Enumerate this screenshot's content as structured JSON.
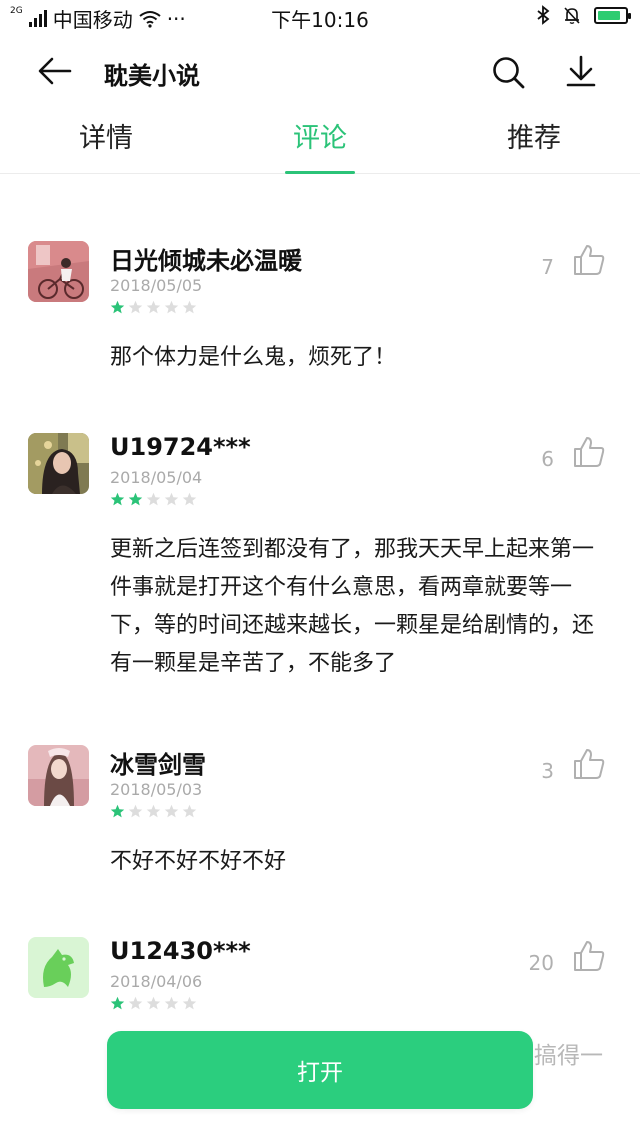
{
  "status_bar": {
    "network": "2G",
    "carrier": "中国移动",
    "more": "···",
    "time": "下午10:16",
    "battery_level": 0.85
  },
  "header": {
    "title": "耽美小说"
  },
  "tabs": [
    {
      "label": "详情",
      "active": false
    },
    {
      "label": "评论",
      "active": true
    },
    {
      "label": "推荐",
      "active": false
    }
  ],
  "comments": [
    {
      "user": "日光倾城未必温暖",
      "date": "2018/05/05",
      "rating": 1,
      "likes": "7",
      "text": "那个体力是什么鬼，烦死了！"
    },
    {
      "user": "U19724***",
      "date": "2018/05/04",
      "rating": 2,
      "likes": "6",
      "text": "更新之后连签到都没有了，那我天天早上起来第一件事就是打开这个有什么意思，看两章就要等一下，等的时间还越来越长，一颗星是给剧情的，还有一颗星是辛苦了，不能多了"
    },
    {
      "user": "冰雪剑雪",
      "date": "2018/05/03",
      "rating": 1,
      "likes": "3",
      "text": "不好不好不好不好"
    },
    {
      "user": "U12430***",
      "date": "2018/04/06",
      "rating": 1,
      "likes": "20",
      "text": ""
    }
  ],
  "open_button": {
    "label": "打开"
  },
  "partial_text": "搞得一",
  "colors": {
    "accent": "#2bc378",
    "star_filled": "#2bc378",
    "star_empty": "#dddddd",
    "open_button": "#2bce7e"
  }
}
